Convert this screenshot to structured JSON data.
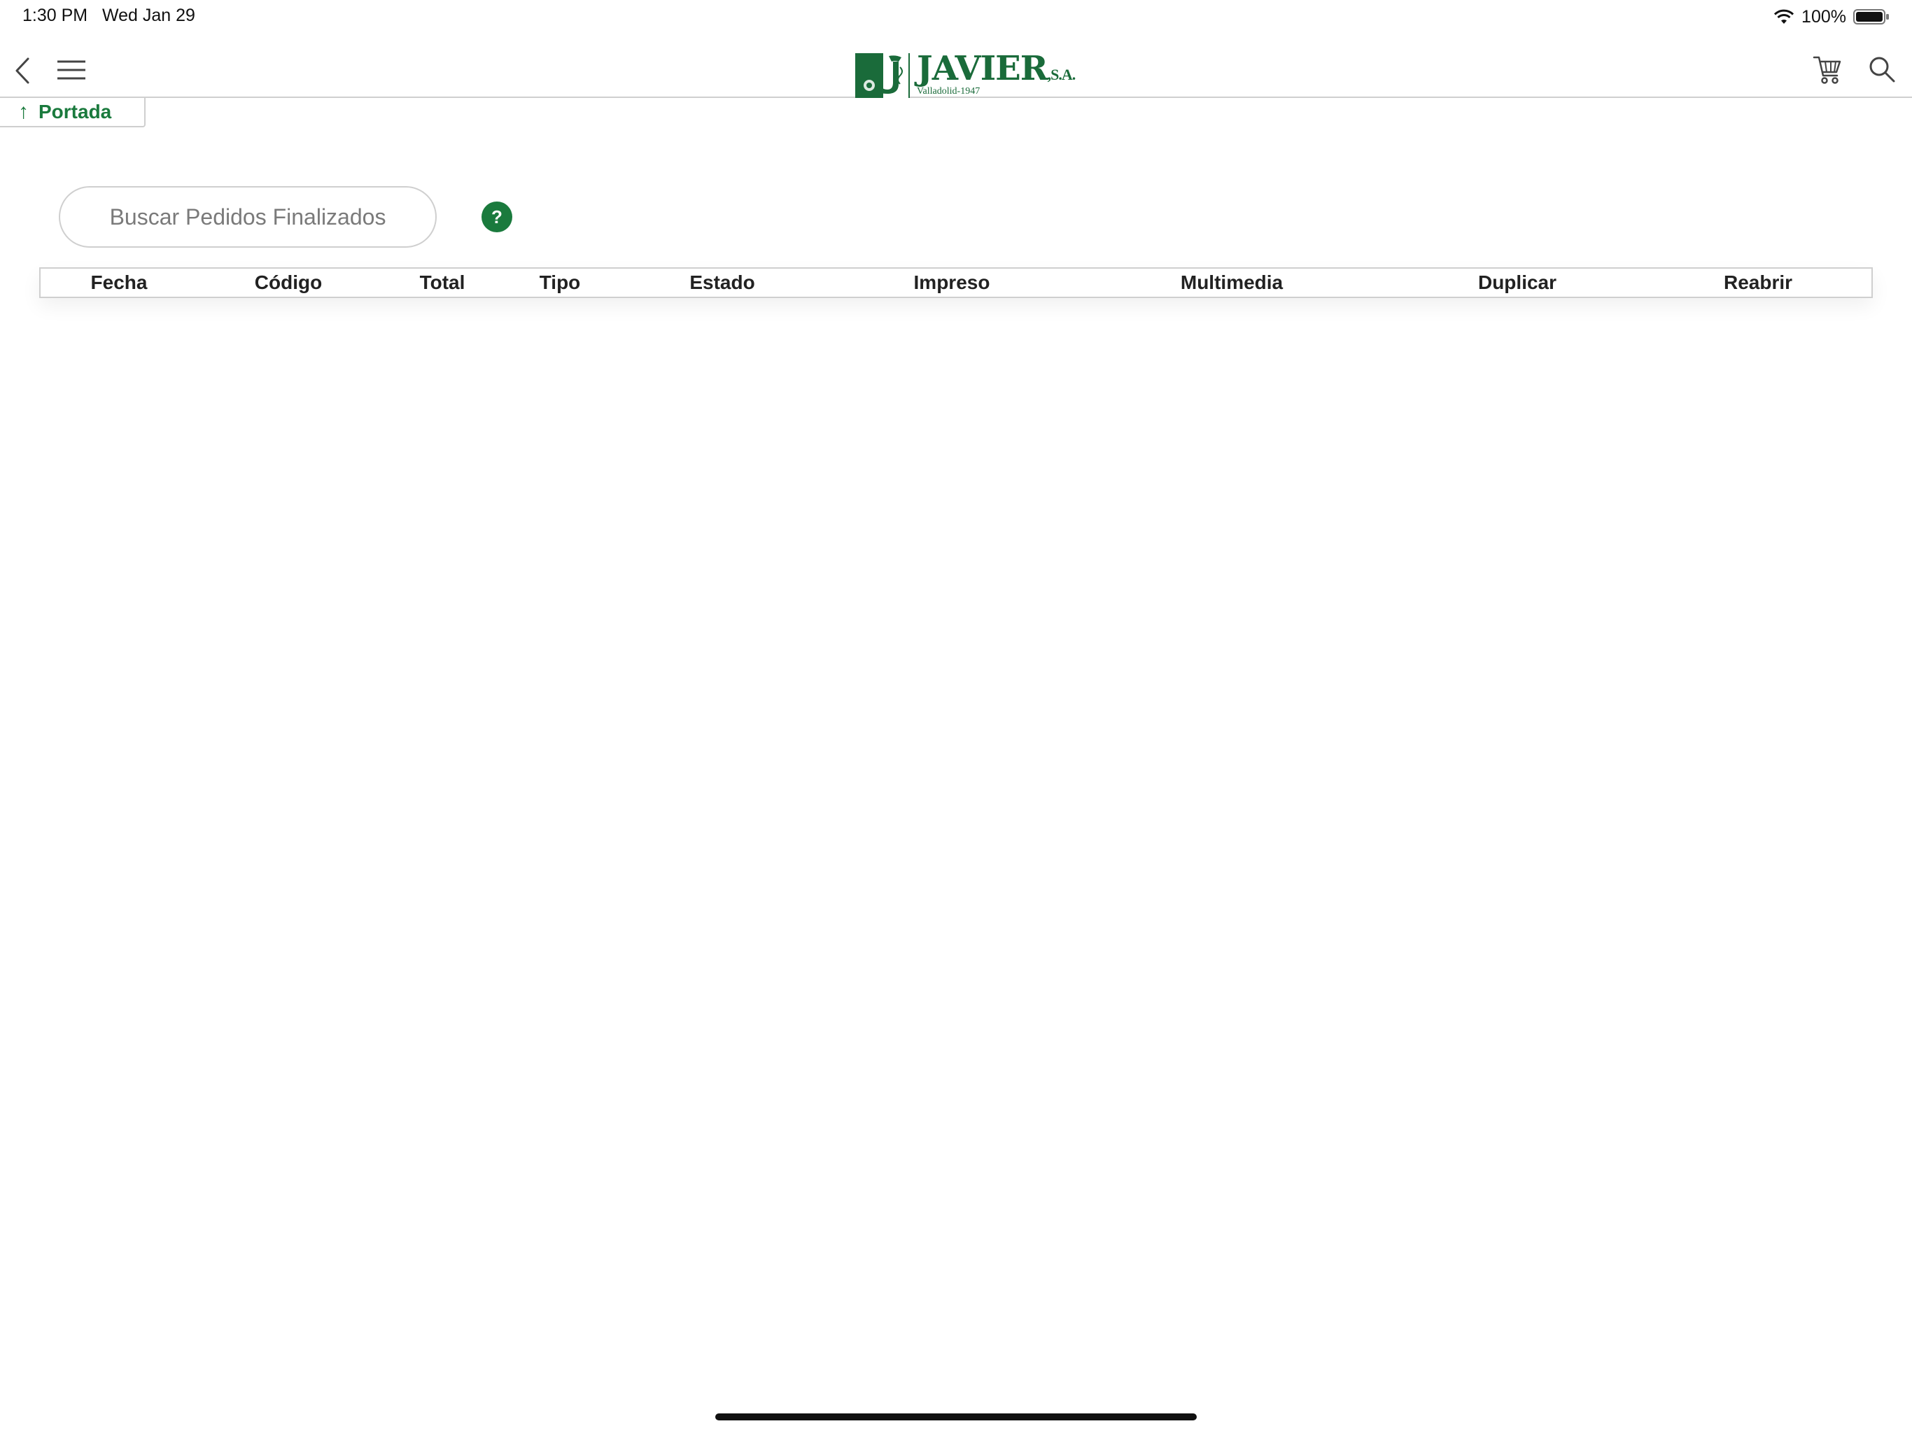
{
  "status_bar": {
    "time": "1:30 PM",
    "date": "Wed Jan 29",
    "battery": "100%",
    "wifi_icon": "wifi-icon",
    "battery_icon": "battery-icon"
  },
  "nav": {
    "back_icon": "chevron-left-icon",
    "menu_icon": "hamburger-menu-icon",
    "logo": {
      "name": "JAVIER",
      "suffix": ",S.A.",
      "subtitle": "Valladolid-1947"
    },
    "cart_icon": "cart-icon",
    "search_icon": "search-icon"
  },
  "breadcrumb": {
    "arrow": "↑",
    "label": "Portada"
  },
  "search": {
    "placeholder": "Buscar Pedidos Finalizados",
    "value": "",
    "help_label": "?"
  },
  "table": {
    "columns": [
      "Fecha",
      "Código",
      "Total",
      "Tipo",
      "Estado",
      "Impreso",
      "Multimedia",
      "Duplicar",
      "Reabrir"
    ],
    "rows": []
  },
  "colors": {
    "brand_green": "#1a7a3d",
    "logo_green": "#1a6b3a",
    "border": "#cfcfcf"
  }
}
